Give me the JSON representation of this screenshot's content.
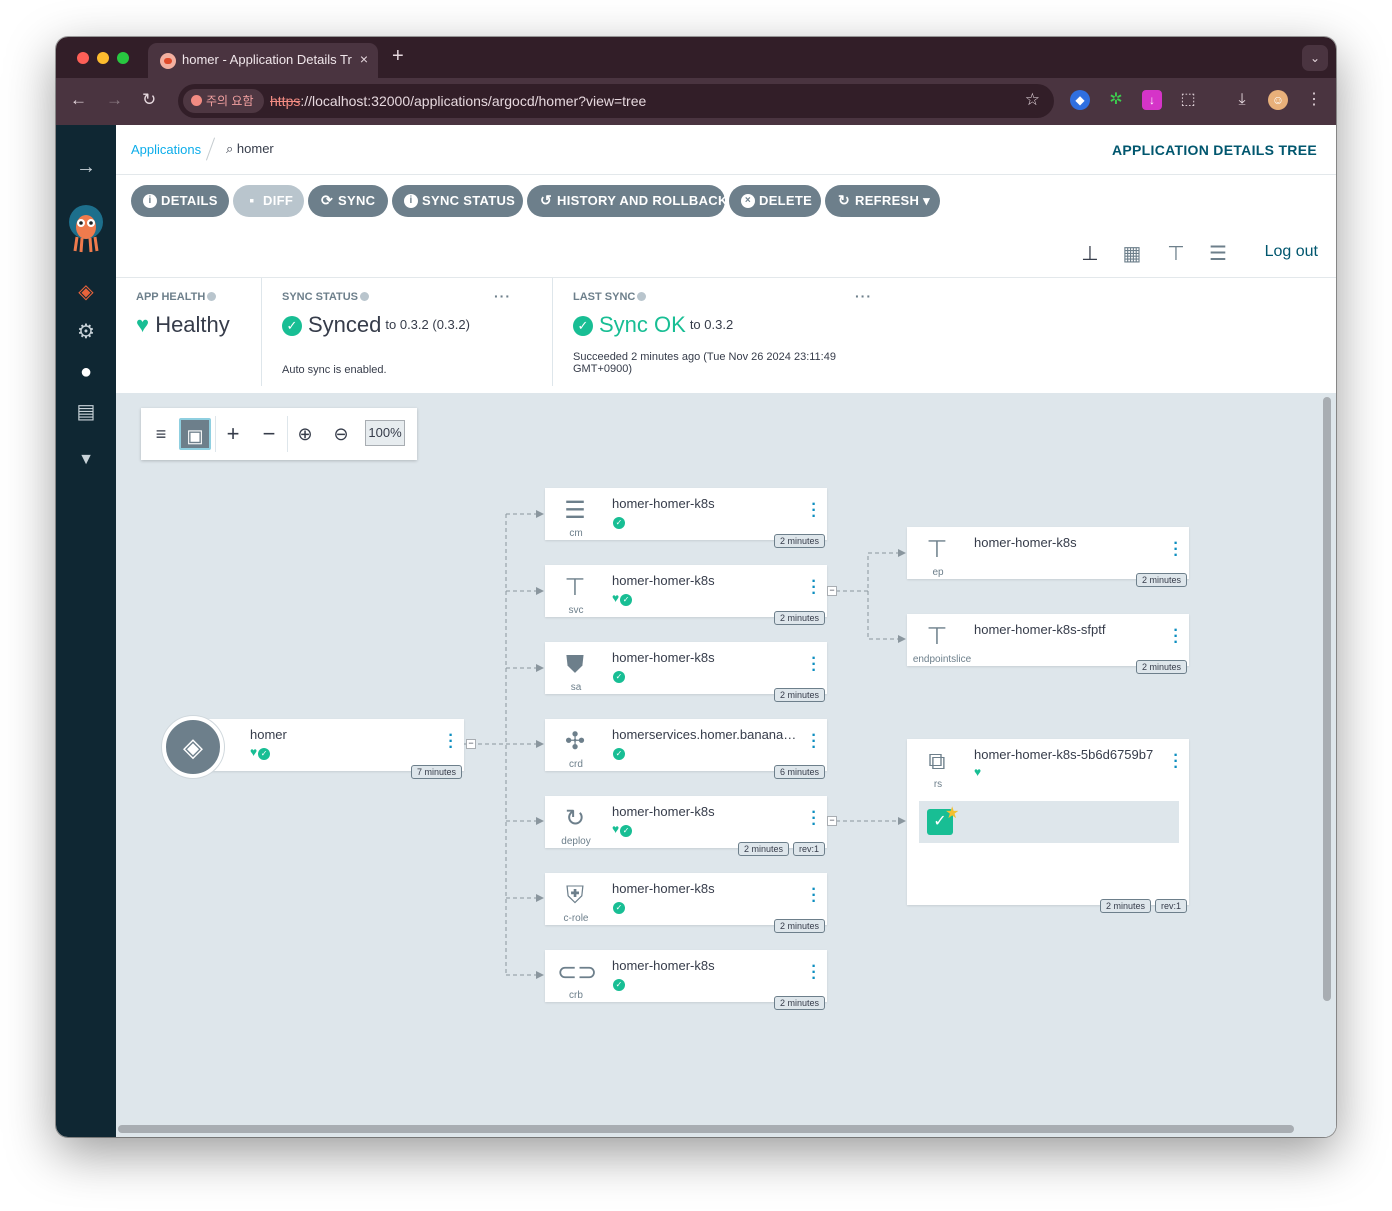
{
  "browser": {
    "tab_title": "homer - Application Details Tree",
    "tab_close": "×",
    "new_tab": "+",
    "menu": "⌄",
    "security_chip": "주의 요함",
    "url_scheme": "https",
    "url_rest": "://localhost:32000/applications/argocd/homer?view=tree"
  },
  "breadcrumb": {
    "link": "Applications",
    "current": "homer"
  },
  "page_title": "APPLICATION DETAILS TREE",
  "actions": [
    {
      "label": "DETAILS",
      "icon": "info-icon"
    },
    {
      "label": "DIFF",
      "icon": "file-diff-icon",
      "disabled": true
    },
    {
      "label": "SYNC",
      "icon": "sync-icon"
    },
    {
      "label": "SYNC STATUS",
      "icon": "info-icon"
    },
    {
      "label": "HISTORY AND ROLLBACK",
      "icon": "history-icon"
    },
    {
      "label": "DELETE",
      "icon": "times-circle-icon"
    },
    {
      "label": "REFRESH",
      "icon": "redo-icon"
    }
  ],
  "views": {
    "logout": "Log out",
    "icons": [
      "tree-view-icon",
      "pods-view-icon",
      "network-view-icon",
      "list-view-icon"
    ]
  },
  "status": {
    "app_health": {
      "label": "APP HEALTH",
      "value": "Healthy"
    },
    "sync_status": {
      "label": "SYNC STATUS",
      "value": "Synced",
      "to": "to 0.3.2 (0.3.2)",
      "note": "Auto sync is enabled.",
      "menu": "···"
    },
    "last_sync": {
      "label": "LAST SYNC",
      "value": "Sync OK",
      "to": "to 0.3.2",
      "note1": "Succeeded 2 minutes ago (Tue Nov 26 2024 23:11:49",
      "note2": "GMT+0900)",
      "menu": "···"
    }
  },
  "zoom": {
    "value": "100%"
  },
  "tree": {
    "root": {
      "name": "homer",
      "time": "7 minutes"
    },
    "children": [
      {
        "name": "homer-homer-k8s",
        "kind": "cm",
        "time": "2 minutes",
        "health": false
      },
      {
        "name": "homer-homer-k8s",
        "kind": "svc",
        "time": "2 minutes",
        "health": true
      },
      {
        "name": "homer-homer-k8s",
        "kind": "sa",
        "time": "2 minutes",
        "health": false
      },
      {
        "name": "homerservices.homer.bananaops.io",
        "kind": "crd",
        "time": "6 minutes",
        "health": false
      },
      {
        "name": "homer-homer-k8s",
        "kind": "deploy",
        "time": "2 minutes",
        "rev": "rev:1",
        "health": true
      },
      {
        "name": "homer-homer-k8s",
        "kind": "c-role",
        "time": "2 minutes",
        "health": false
      },
      {
        "name": "homer-homer-k8s",
        "kind": "crb",
        "time": "2 minutes",
        "health": false
      }
    ],
    "grandchildren": [
      {
        "name": "homer-homer-k8s",
        "kind": "ep",
        "time": "2 minutes"
      },
      {
        "name": "homer-homer-k8s-sfptf",
        "kind": "endpointslice",
        "time": "2 minutes"
      },
      {
        "name": "homer-homer-k8s-5b6d6759b7",
        "kind": "rs",
        "time": "2 minutes",
        "rev": "rev:1"
      }
    ]
  },
  "colors": {
    "sidebar": "#0f2733",
    "accent": "#00566e",
    "healthy": "#18be94",
    "button": "#6d7f8b",
    "canvas": "#dee6eb"
  }
}
